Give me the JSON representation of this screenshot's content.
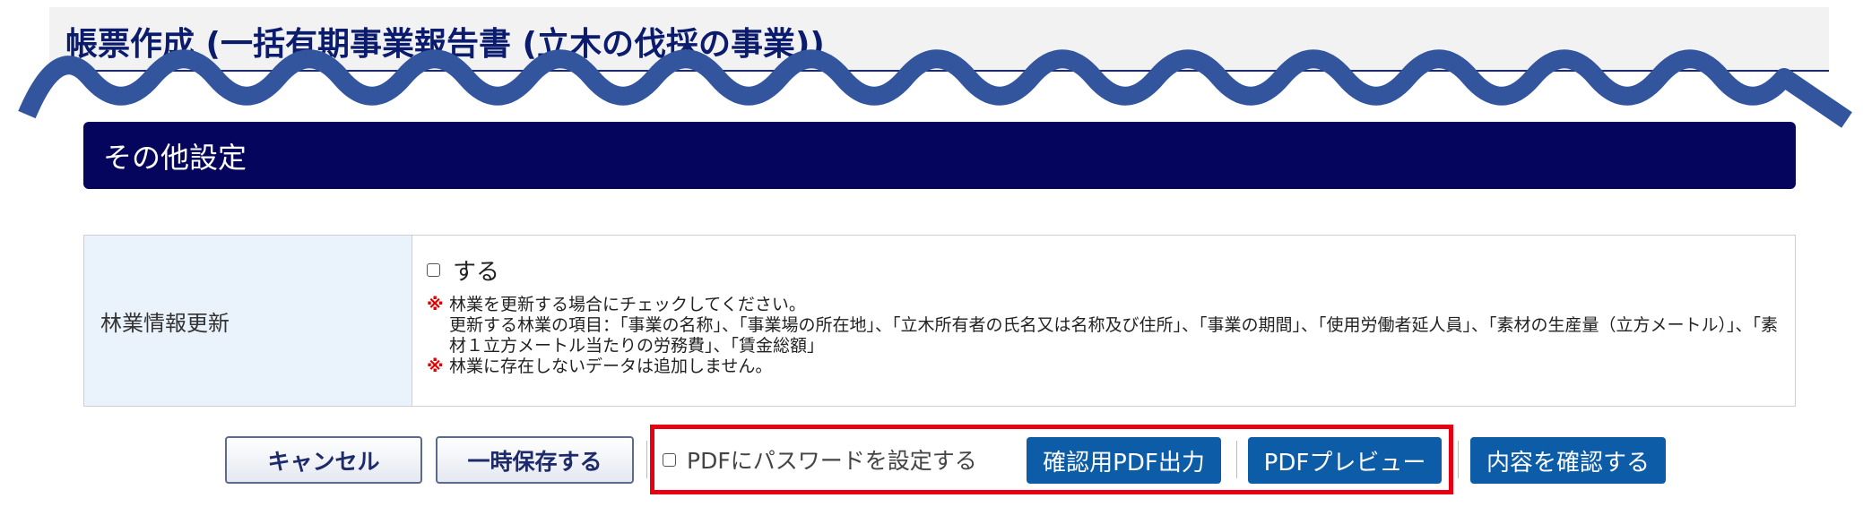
{
  "header": {
    "title": "帳票作成 (一括有期事業報告書 (立木の伐採の事業))"
  },
  "section": {
    "title": "その他設定"
  },
  "forestry_update": {
    "label": "林業情報更新",
    "checkbox_label": "する",
    "notes": [
      {
        "mark": "※",
        "text": "林業を更新する場合にチェックしてください。"
      },
      {
        "mark": "",
        "text": "更新する林業の項目：「事業の名称」、「事業場の所在地」、「立木所有者の氏名又は名称及び住所」、「事業の期間」、「使用労働者延人員」、「素材の生産量（立方メートル）」、「素材１立方メートル当たりの労務費」、「賃金総額」"
      },
      {
        "mark": "※",
        "text": "林業に存在しないデータは追加しません。"
      }
    ]
  },
  "actions": {
    "cancel": "キャンセル",
    "save_temp": "一時保存する",
    "pdf_password": "PDFにパスワードを設定する",
    "confirm_pdf": "確認用PDF出力",
    "pdf_preview": "PDFプレビュー",
    "confirm": "内容を確認する"
  },
  "colors": {
    "title": "#0b1c6e",
    "section_bar": "#05055e",
    "table_header_bg": "#eaf2fb",
    "note_mark": "#e00000",
    "primary_button": "#0d5ca8",
    "highlight_frame": "#e60012",
    "wave": "#32559e"
  }
}
